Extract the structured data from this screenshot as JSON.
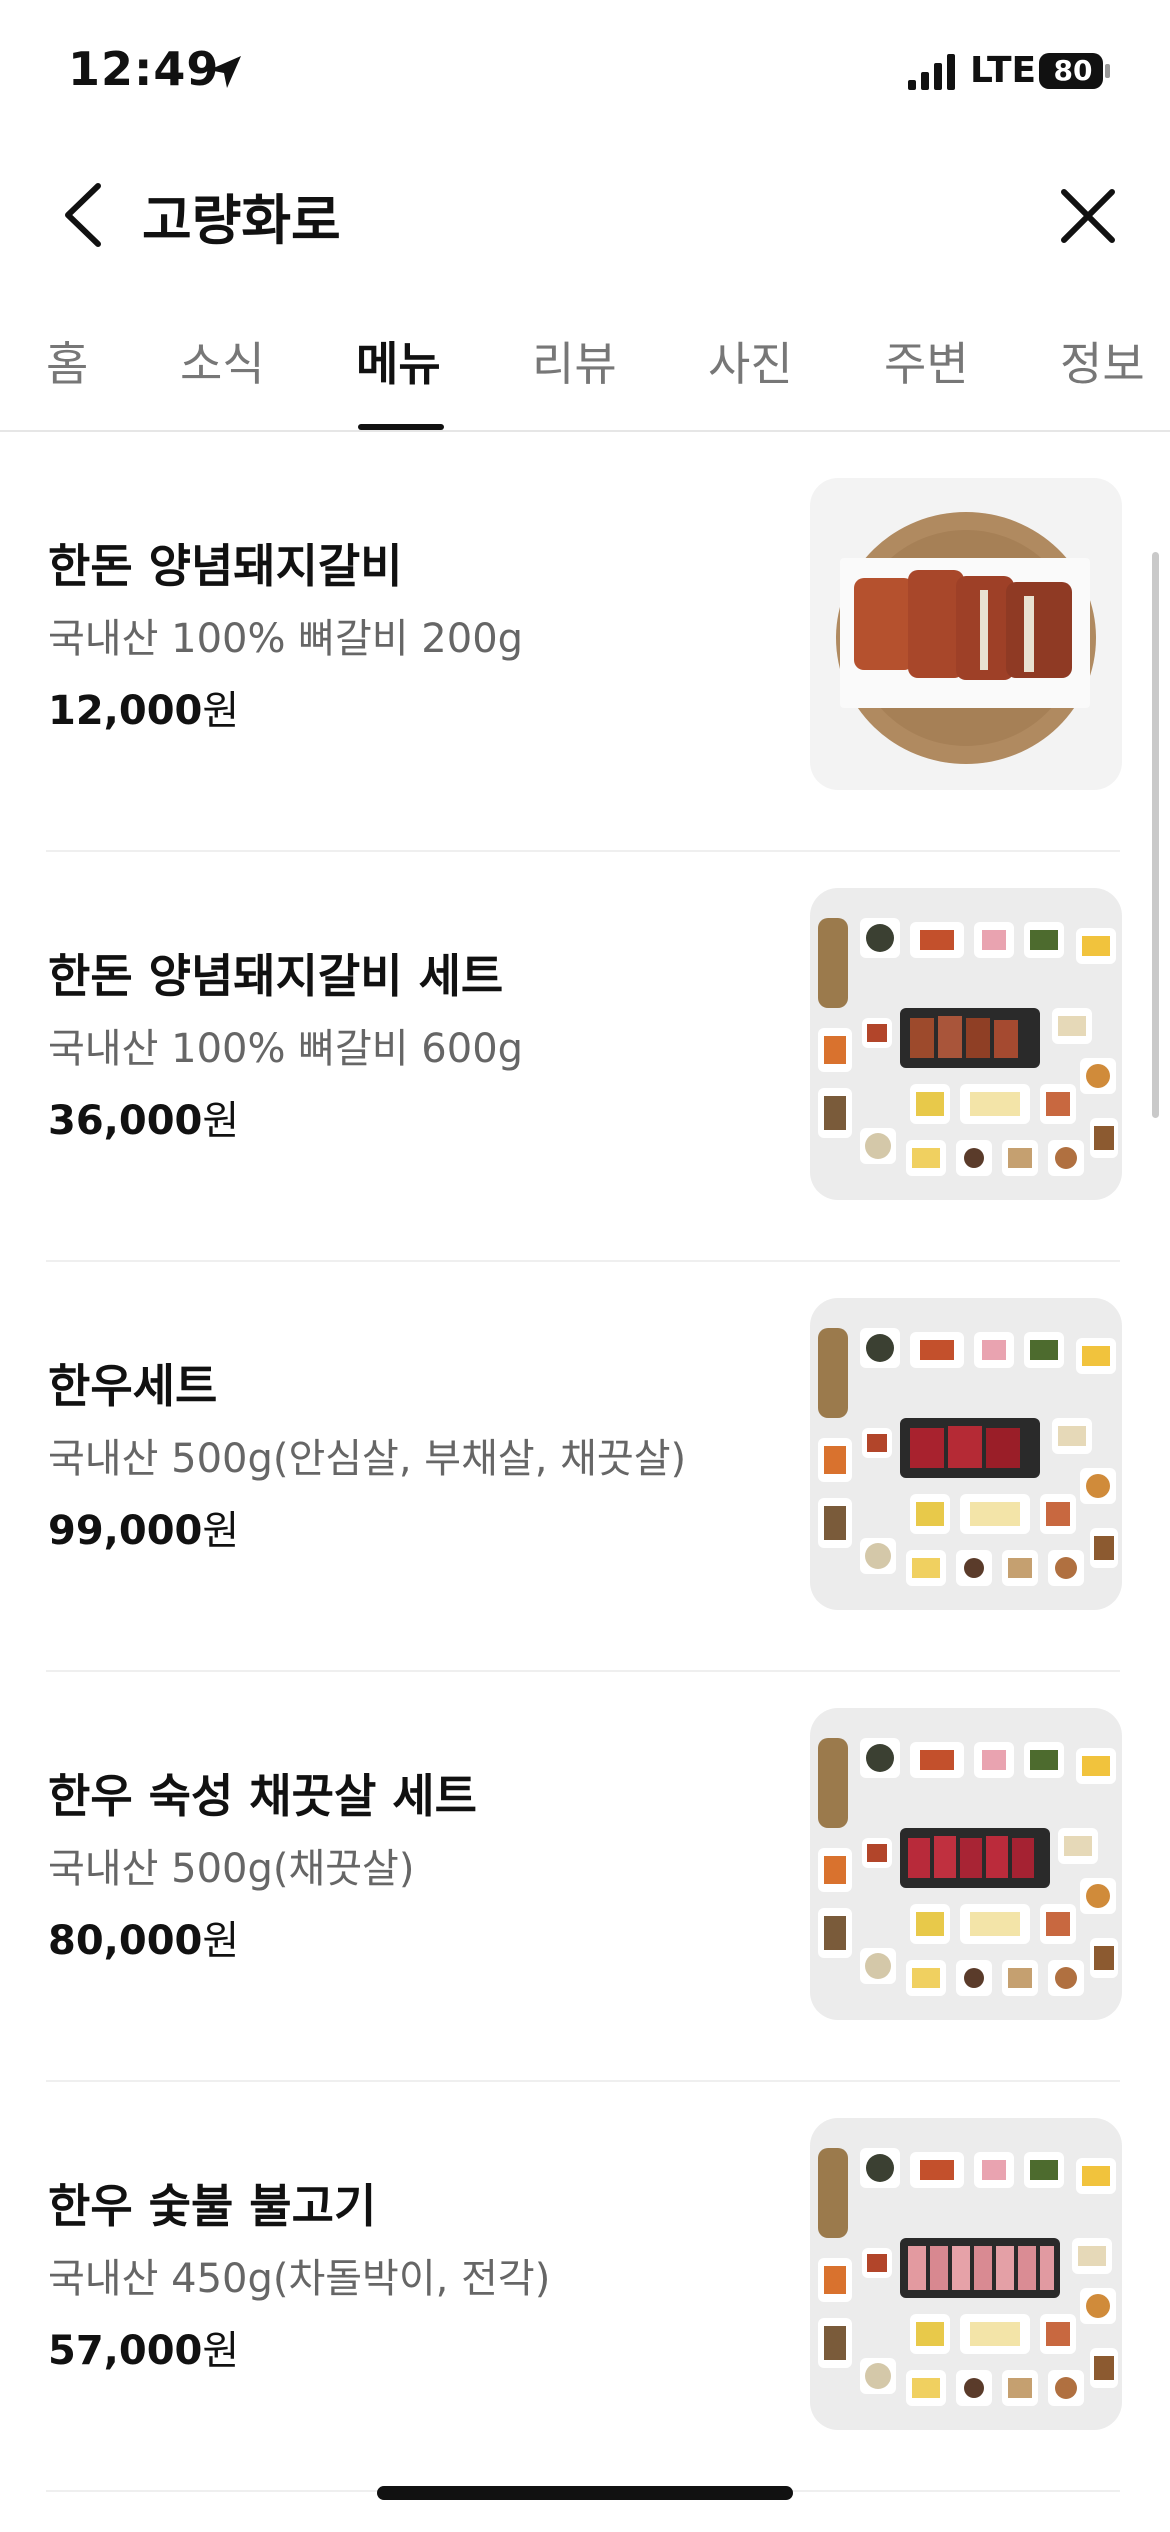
{
  "status": {
    "time": "12:49",
    "network": "LTE",
    "battery": "80"
  },
  "header": {
    "title": "고량화로"
  },
  "tabs": [
    {
      "label": "홈"
    },
    {
      "label": "소식"
    },
    {
      "label": "메뉴"
    },
    {
      "label": "리뷰"
    },
    {
      "label": "사진"
    },
    {
      "label": "주변"
    },
    {
      "label": "정보"
    }
  ],
  "active_tab": "메뉴",
  "menu": [
    {
      "name": "한돈 양념돼지갈비",
      "desc": "국내산 100% 뼈갈비 200g",
      "price": "12,000",
      "unit": "원",
      "image": "pork-rib-photo"
    },
    {
      "name": "한돈 양념돼지갈비 세트",
      "desc": "국내산 100% 뼈갈비 600g",
      "price": "36,000",
      "unit": "원",
      "image": "pork-rib-set-photo"
    },
    {
      "name": "한우세트",
      "desc": "국내산 500g(안심살, 부채살, 채끗살)",
      "price": "99,000",
      "unit": "원",
      "image": "hanwoo-set-photo"
    },
    {
      "name": "한우 숙성 채끗살 세트",
      "desc": "국내산 500g(채끗살)",
      "price": "80,000",
      "unit": "원",
      "image": "aged-beef-set-photo"
    },
    {
      "name": "한우 숯불 불고기",
      "desc": "국내산 450g(차돌박이, 전각)",
      "price": "57,000",
      "unit": "원",
      "image": "bulgogi-set-photo"
    }
  ]
}
